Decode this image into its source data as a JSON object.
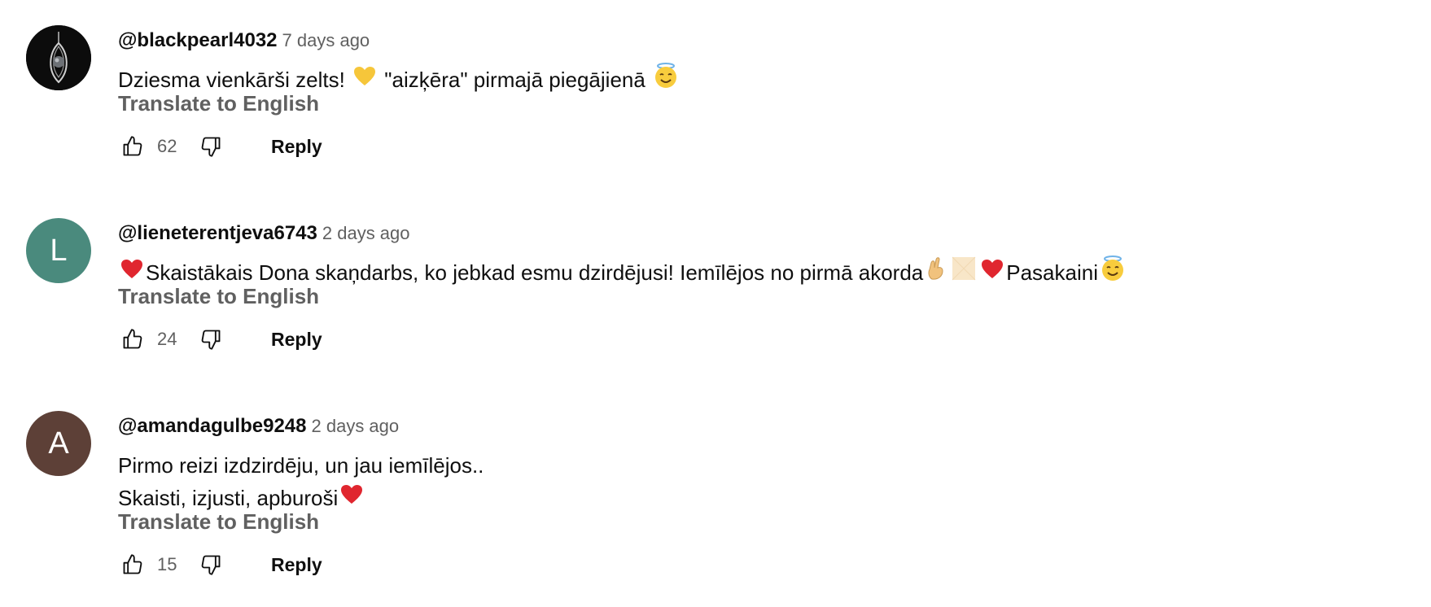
{
  "comments": [
    {
      "author": "@blackpearl4032",
      "time": "7 days ago",
      "avatar_type": "photo",
      "avatar_letter": "",
      "avatar_color": "#101010",
      "lines": [
        {
          "parts": [
            "Dziesma vienkārši zelts! ",
            "yellow-heart-emoji",
            " \"aizķēra\" pirmajā piegājienā ",
            "smiling-halo-emoji"
          ]
        }
      ],
      "translate": "Translate to English",
      "likes": "62",
      "reply": "Reply"
    },
    {
      "author": "@lieneterentjeva6743",
      "time": "2 days ago",
      "avatar_type": "letter",
      "avatar_letter": "L",
      "avatar_color": "#4a8a7d",
      "lines": [
        {
          "parts": [
            "red-heart-emoji",
            "Skaistākais Dona skaņdarbs, ko jebkad esmu dzirdējusi! Iemīlējos no pirmā akorda",
            "crossed-fingers-emoji",
            "placeholder-emoji",
            "red-heart-emoji",
            "Pasakaini",
            "smiling-halo-emoji"
          ]
        }
      ],
      "translate": "Translate to English",
      "likes": "24",
      "reply": "Reply"
    },
    {
      "author": "@amandagulbe9248",
      "time": "2 days ago",
      "avatar_type": "letter",
      "avatar_letter": "A",
      "avatar_color": "#5d4037",
      "lines": [
        {
          "parts": [
            "Pirmo reizi izdzirdēju, un jau iemīlējos.."
          ]
        },
        {
          "parts": [
            "Skaisti, izjusti, apburoši",
            "red-heart-emoji"
          ]
        }
      ],
      "translate": "Translate to English",
      "likes": "15",
      "reply": "Reply"
    }
  ]
}
